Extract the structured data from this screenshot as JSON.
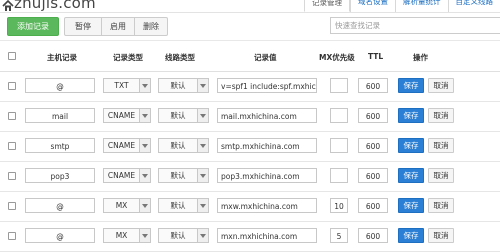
{
  "header": {
    "domain": "zhujis.com",
    "tabs": [
      {
        "label": "记录管理",
        "active": true
      },
      {
        "label": "域名设置",
        "active": false
      },
      {
        "label": "解析量统计",
        "active": false
      },
      {
        "label": "自定义线路",
        "active": false
      }
    ]
  },
  "toolbar": {
    "add_label": "添加记录",
    "pause_label": "暂停",
    "enable_label": "启用",
    "delete_label": "删除",
    "search_placeholder": "快速查找记录"
  },
  "table": {
    "columns": {
      "host": "主机记录",
      "type": "记录类型",
      "line": "线路类型",
      "value": "记录值",
      "mx": "MX优先级",
      "ttl": "TTL",
      "ops": "操作"
    },
    "rows": [
      {
        "host": "@",
        "type": "TXT",
        "line": "默认",
        "value": "v=spf1 include:spf.mxhichi",
        "mx": "",
        "ttl": "600",
        "save": "保存",
        "cancel": "取消"
      },
      {
        "host": "mail",
        "type": "CNAME",
        "line": "默认",
        "value": "mail.mxhichina.com",
        "mx": "",
        "ttl": "600",
        "save": "保存",
        "cancel": "取消"
      },
      {
        "host": "smtp",
        "type": "CNAME",
        "line": "默认",
        "value": "smtp.mxhichina.com",
        "mx": "",
        "ttl": "600",
        "save": "保存",
        "cancel": "取消"
      },
      {
        "host": "pop3",
        "type": "CNAME",
        "line": "默认",
        "value": "pop3.mxhichina.com",
        "mx": "",
        "ttl": "600",
        "save": "保存",
        "cancel": "取消"
      },
      {
        "host": "@",
        "type": "MX",
        "line": "默认",
        "value": "mxw.mxhichina.com",
        "mx": "10",
        "ttl": "600",
        "save": "保存",
        "cancel": "取消"
      },
      {
        "host": "@",
        "type": "MX",
        "line": "默认",
        "value": "mxn.mxhichina.com",
        "mx": "5",
        "ttl": "600",
        "save": "保存",
        "cancel": "取消"
      }
    ]
  },
  "colors": {
    "add_button": "#5cb85c",
    "save_button": "#2b7fd4",
    "tab_link": "#1b6ec2"
  },
  "icons": {
    "home": "home-icon",
    "dropdown": "chevron-down-icon",
    "checkbox": "checkbox"
  }
}
